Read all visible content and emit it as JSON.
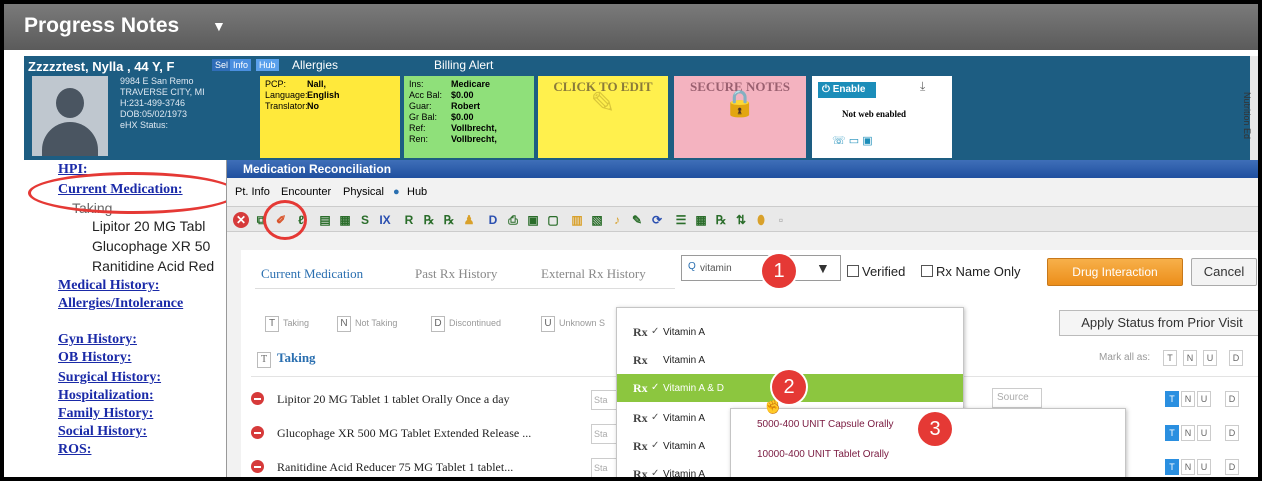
{
  "window": {
    "title": "Progress Notes"
  },
  "patient": {
    "name": "Zzzzztest, Nylla , 44 Y, F",
    "badges": [
      "Sel",
      "Info",
      "Hub"
    ],
    "labels": [
      "Allergies",
      "Billing Alert"
    ],
    "address_lines": [
      "9984 E San Remo",
      "TRAVERSE CITY, MI",
      "H:231-499-3746",
      "DOB:05/02/1973",
      "eHX Status:"
    ],
    "pcp_card": [
      {
        "k": "PCP:",
        "v": "Nall,"
      },
      {
        "k": "Language:",
        "v": "English"
      },
      {
        "k": "Translator:",
        "v": "No"
      }
    ],
    "ins_card": [
      {
        "k": "Ins:",
        "v": "Medicare"
      },
      {
        "k": "Acc Bal:",
        "v": "$0.00"
      },
      {
        "k": "Guar:",
        "v": "Robert"
      },
      {
        "k": "Gr Bal:",
        "v": "$0.00"
      },
      {
        "k": "Ref:",
        "v": "Vollbrecht,"
      },
      {
        "k": "Ren:",
        "v": "Vollbrecht,"
      }
    ],
    "click_to_edit": "CLICK TO EDIT",
    "secure_notes": "SECURE NOTES",
    "enable_label": "Enable",
    "not_web_enabled": "Not web enabled",
    "right_tab": "Nutrition Ed"
  },
  "leftnav": {
    "hpi": "HPI:",
    "current_medication": "Current Medication:",
    "taking": "Taking",
    "meds": [
      "Lipitor 20 MG Tabl",
      "Glucophage XR 50",
      "Ranitidine Acid Red"
    ],
    "links": [
      "Medical History:",
      "Allergies/Intolerance",
      "Gyn History:",
      "OB History:",
      "Surgical History:",
      "Hospitalization:",
      "Family History:",
      "Social History:",
      "ROS:"
    ]
  },
  "med_rec": {
    "title": "Medication Reconciliation",
    "menu": [
      "Pt. Info",
      "Encounter",
      "Physical",
      "Hub"
    ],
    "tabs": [
      "Current Medication",
      "Past Rx History",
      "External Rx History"
    ],
    "search_value": "vitamin",
    "verified_label": "Verified",
    "rx_name_only_label": "Rx Name Only",
    "drug_interaction_label": "Drug Interaction",
    "cancel_label": "Cancel",
    "filters": [
      {
        "code": "T",
        "label": "Taking"
      },
      {
        "code": "N",
        "label": "Not Taking"
      },
      {
        "code": "D",
        "label": "Discontinued"
      },
      {
        "code": "U",
        "label": "Unknown S"
      }
    ],
    "apply_status_label": "Apply Status from Prior Visit",
    "taking_header": "Taking",
    "taking_code": "T",
    "mark_all_label": "Mark all as:",
    "mark_codes": [
      "T",
      "N",
      "U",
      "D"
    ],
    "field_placeholder": "Sta",
    "source_placeholder": "Source",
    "medications": [
      "Lipitor 20 MG Tablet 1 tablet Orally Once a day",
      "Glucophage XR 500 MG Tablet Extended Release ...",
      "Ranitidine Acid Reducer 75 MG Tablet 1 tablet..."
    ]
  },
  "dropdown": {
    "rx_symbol": "Rx",
    "items": [
      {
        "name": "Vitamin A",
        "checked": true
      },
      {
        "name": "Vitamin A",
        "checked": false
      },
      {
        "name": "Vitamin A & D",
        "checked": true
      },
      {
        "name": "Vitamin A",
        "checked": true
      },
      {
        "name": "Vitamin A",
        "checked": true
      },
      {
        "name": "Vitamin A",
        "checked": true
      }
    ],
    "sub_items": [
      "5000-400 UNIT Capsule Orally",
      "10000-400 UNIT Tablet Orally"
    ]
  },
  "steps": [
    "1",
    "2",
    "3"
  ]
}
